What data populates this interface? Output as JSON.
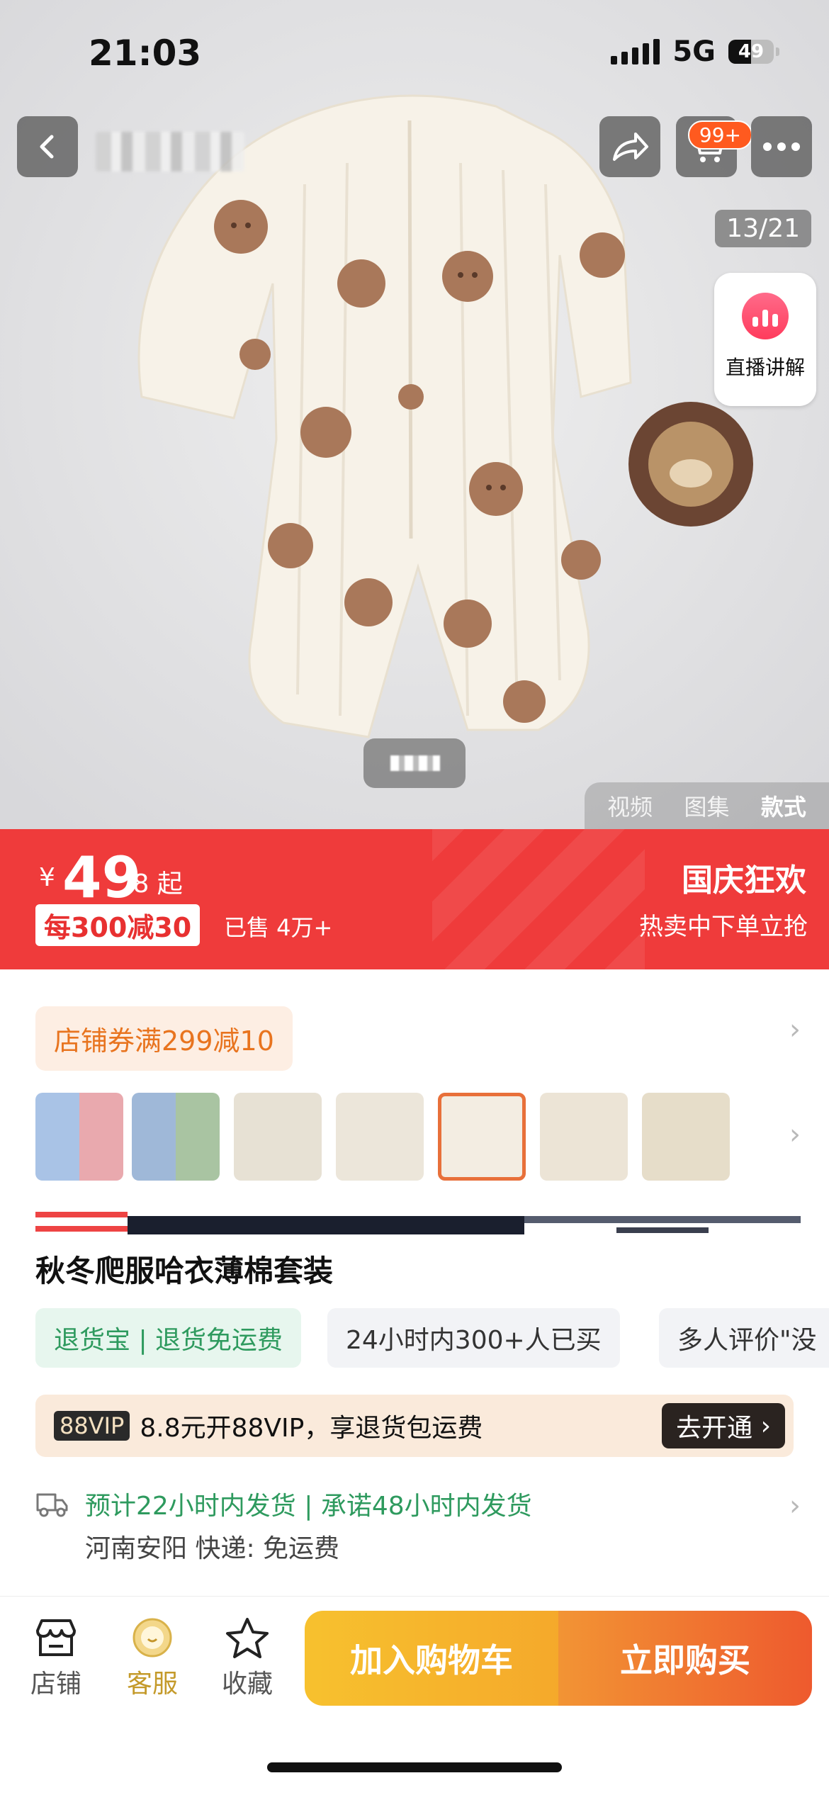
{
  "status_bar": {
    "time": "21:03",
    "network": "5G",
    "battery": "49"
  },
  "hero": {
    "cart_badge": "99+",
    "image_counter": "13/21",
    "live_label": "直播讲解",
    "media_tabs": [
      "视频",
      "图集",
      "款式"
    ],
    "active_media_tab": "款式"
  },
  "price": {
    "currency": "¥",
    "integer": "49",
    "decimal_suffix": ".8 起",
    "discount": "每300减30",
    "sold": "已售 4万+",
    "promo_title": "国庆狂欢",
    "promo_sub": "热卖中下单立抢"
  },
  "details": {
    "shop_coupon": "店铺券满299减10",
    "title_line": "秋冬爬服哈衣薄棉套装",
    "tags": [
      "退货宝 | 退货免运费",
      "24小时内300+人已买",
      "多人评价\"没"
    ],
    "vip_badge": "88VIP",
    "vip_text": "8.8元开88VIP，享退货包运费",
    "vip_button": "去开通",
    "shipping_line": "预计22小时内发货 | 承诺48小时内发货",
    "origin_line": "河南安阳  快递: 免运费"
  },
  "bottom": {
    "store": "店铺",
    "service": "客服",
    "favorite": "收藏",
    "add_to_cart": "加入购物车",
    "buy_now": "立即购买"
  },
  "colors": {
    "accent_red": "#ef3b3b",
    "orange": "#ee5a2e",
    "yellow": "#f7c12e",
    "green": "#2e9a5e"
  }
}
